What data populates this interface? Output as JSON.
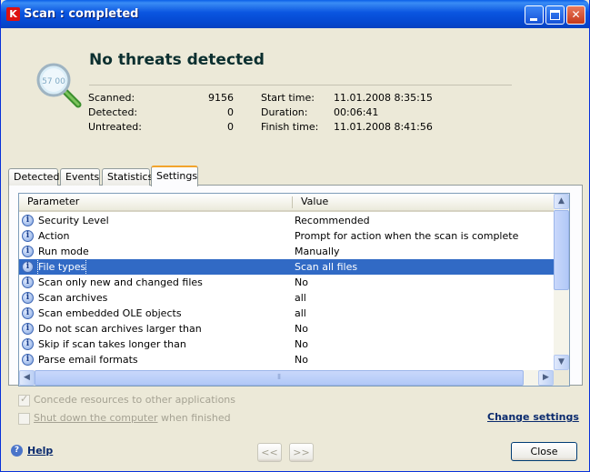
{
  "window": {
    "title": "Scan : completed",
    "app_icon_letter": "K"
  },
  "summary": {
    "headline": "No threats detected",
    "stats": [
      {
        "label": "Scanned:",
        "value": "9156"
      },
      {
        "label": "Detected:",
        "value": "0"
      },
      {
        "label": "Untreated:",
        "value": "0"
      }
    ],
    "times": [
      {
        "label": "Start time:",
        "value": "11.01.2008 8:35:15"
      },
      {
        "label": "Duration:",
        "value": "00:06:41"
      },
      {
        "label": "Finish time:",
        "value": "11.01.2008 8:41:56"
      }
    ],
    "icon_text": "57 00"
  },
  "tabs": [
    {
      "label": "Detected",
      "active": false
    },
    {
      "label": "Events",
      "active": false
    },
    {
      "label": "Statistics",
      "active": false
    },
    {
      "label": "Settings",
      "active": true
    }
  ],
  "grid": {
    "columns": [
      "Parameter",
      "Value"
    ],
    "rows": [
      {
        "parameter": "Security Level",
        "value": "Recommended"
      },
      {
        "parameter": "Action",
        "value": "Prompt for action when the scan is complete"
      },
      {
        "parameter": "Run mode",
        "value": "Manually"
      },
      {
        "parameter": "File types",
        "value": "Scan all files",
        "selected": true
      },
      {
        "parameter": "Scan only new and changed files",
        "value": "No"
      },
      {
        "parameter": "Scan archives",
        "value": "all"
      },
      {
        "parameter": "Scan embedded OLE objects",
        "value": "all"
      },
      {
        "parameter": "Do not scan archives larger than",
        "value": "No"
      },
      {
        "parameter": "Skip if scan takes longer than",
        "value": "No"
      },
      {
        "parameter": "Parse email formats",
        "value": "No"
      }
    ]
  },
  "options": {
    "concede_label": "Concede resources to other applications",
    "concede_checked": true,
    "shutdown_link": "Shut down the computer",
    "shutdown_suffix": "when finished",
    "shutdown_checked": false
  },
  "footer": {
    "change_settings": "Change settings",
    "help": "Help",
    "prev": "<<",
    "next": ">>",
    "close": "Close"
  },
  "colors": {
    "title_bar": "#0a55e0",
    "selection": "#316ac5",
    "active_tab_accent": "#f2a42c"
  }
}
